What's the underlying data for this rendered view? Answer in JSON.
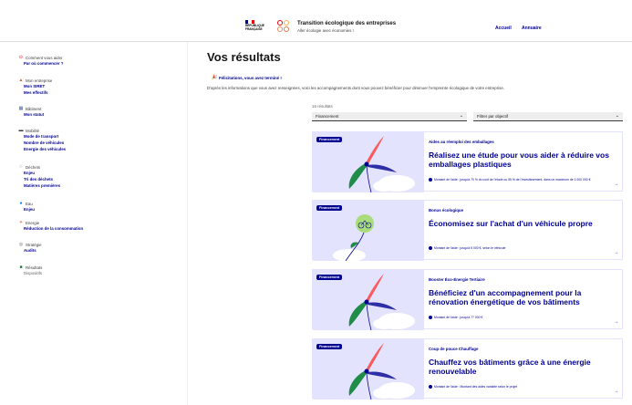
{
  "header": {
    "republique_lines": [
      "RÉPUBLIQUE",
      "FRANÇAISE"
    ],
    "site_title": "Transition écologique des entreprises",
    "site_subtitle": "Aller écologie avec économies !",
    "nav": [
      "Accueil",
      "Annuaire"
    ]
  },
  "sidebar": {
    "sections": [
      {
        "title": "Comment vous aider",
        "icon": "help-circle-icon",
        "color": "#e1000f",
        "items": [
          {
            "label": "Par où commencer ?",
            "active": true
          }
        ]
      },
      {
        "title": "Mon entreprise",
        "icon": "building-icon",
        "color": "#ce614a",
        "items": [
          {
            "label": "Mon SIRET",
            "active": true
          },
          {
            "label": "Mes effectifs",
            "active": true
          }
        ]
      },
      {
        "title": "Bâtiment",
        "icon": "building-square-icon",
        "color": "#465f9d",
        "items": [
          {
            "label": "Mon statut",
            "active": true
          }
        ]
      },
      {
        "title": "Mobilité",
        "icon": "car-icon",
        "color": "#3a3a3a",
        "items": [
          {
            "label": "Mode de transport",
            "active": true
          },
          {
            "label": "Nombre de véhicules",
            "active": true
          },
          {
            "label": "Energie des véhicules",
            "active": true
          }
        ]
      },
      {
        "title": "Déchets",
        "icon": "recycle-icon",
        "color": "#999",
        "items": [
          {
            "label": "Enjeu",
            "active": true
          },
          {
            "label": "Tri des déchets",
            "active": true
          },
          {
            "label": "Matières premières",
            "active": true
          }
        ]
      },
      {
        "title": "Eau",
        "icon": "drop-icon",
        "color": "#0078f3",
        "items": [
          {
            "label": "Enjeu",
            "active": true
          }
        ]
      },
      {
        "title": "Energie",
        "icon": "bolt-icon",
        "color": "#e4794a",
        "items": [
          {
            "label": "Réduction de la consommation",
            "active": true
          }
        ]
      },
      {
        "title": "Stratégie",
        "icon": "target-icon",
        "color": "#666",
        "items": [
          {
            "label": "Audits",
            "active": true
          }
        ]
      },
      {
        "title": "Résultats",
        "icon": "results-icon",
        "color": "#18753c",
        "items": [
          {
            "label": "Dispositifs",
            "active": false
          }
        ]
      }
    ]
  },
  "main": {
    "title": "Vos résultats",
    "congrats": "Félicitations, vous avez terminé !",
    "description": "D'après les informations que vous avez renseignées, voici les accompagnements dont vous pouvez bénéficier pour diminuer l'empreinte écologique de votre entreprise.",
    "count": "16 résultats",
    "filter_left": "Financement",
    "filter_right": "Filtrer par objectif"
  },
  "cards": [
    {
      "badge": "Financement",
      "tag": "Aides au réemploi des emballages",
      "title": "Réalisez une étude pour vous aider à réduire vos emballages plastiques",
      "amount": "Montant de l'aide : jusqu'à 70 % du coût de l'étude ou 55 % de l'investissement, dans un maximum de 1 000 000 €",
      "image": "flower"
    },
    {
      "badge": "Financement",
      "tag": "Bonus écologique",
      "title": "Économisez sur l'achat d'un véhicule propre",
      "amount": "Montant de l'aide : jusqu'à 5 000 €, selon le véhicule",
      "image": "bike"
    },
    {
      "badge": "Financement",
      "tag": "Booster Éco-Énergie Tertiaire",
      "title": "Bénéficiez d'un accompagnement pour la rénovation énergétique de vos bâtiments",
      "amount": "Montant de l'aide : jusqu'à 77 000 €",
      "image": "flower"
    },
    {
      "badge": "Financement",
      "tag": "Coup de pouce Chauffage",
      "title": "Chauffez vos bâtiments grâce à une énergie renouvelable",
      "amount": "Montant de l'aide : Montant des aides variable selon le projet",
      "image": "flower"
    }
  ]
}
